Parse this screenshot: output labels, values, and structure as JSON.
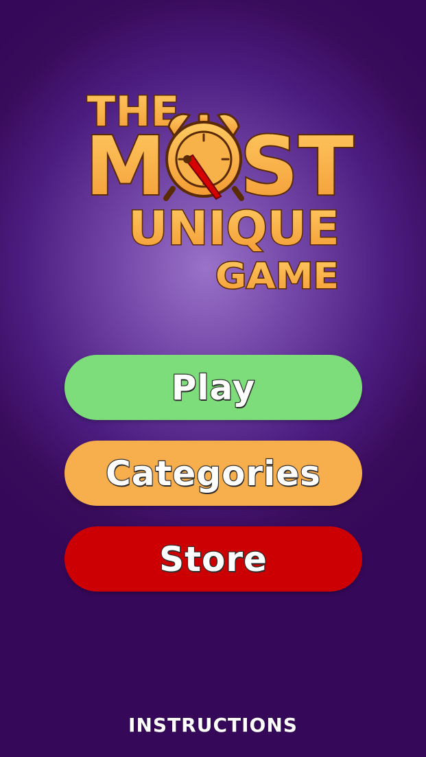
{
  "logo": {
    "line1": "THE",
    "line2_left": "M",
    "line2_right": "ST",
    "line3": "UNIQUE",
    "line4": "GAME"
  },
  "menu": {
    "play_label": "Play",
    "categories_label": "Categories",
    "store_label": "Store"
  },
  "footer": {
    "instructions_label": "INSTRUCTIONS"
  },
  "colors": {
    "background": "#390b5b",
    "logo_fill": "#f8b24a",
    "logo_outline": "#5a2a00",
    "play": "#7ddd7a",
    "categories": "#f7ae4d",
    "store": "#cc0003",
    "clock_hand": "#d60000"
  },
  "icons": [
    "alarm-clock-icon"
  ]
}
